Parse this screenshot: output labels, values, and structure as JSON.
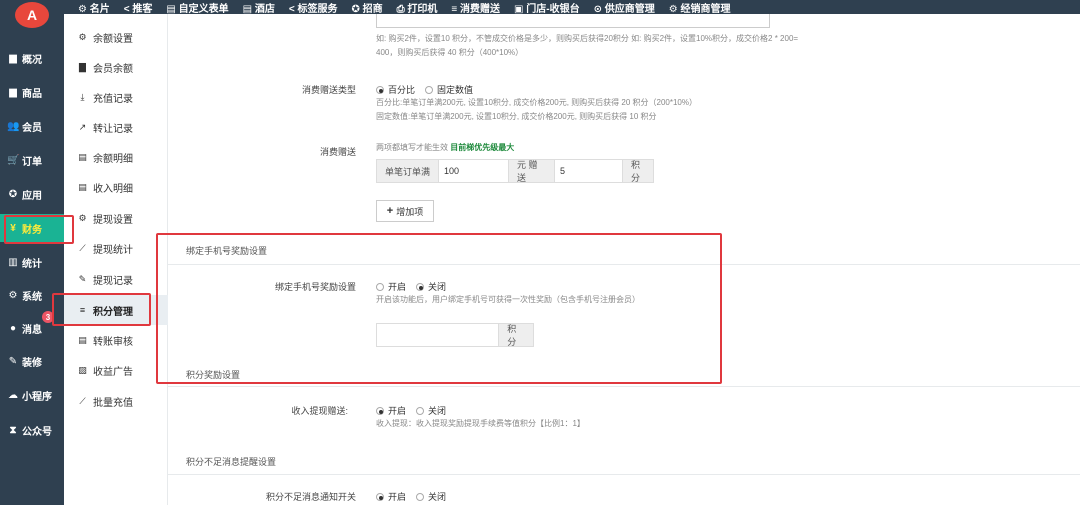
{
  "logo_text": "A",
  "top_nav": [
    "名片",
    "推客",
    "自定义表单",
    "酒店",
    "标签服务",
    "招商",
    "打印机",
    "消费赠送",
    "门店-收银台",
    "供应商管理",
    "经销商管理"
  ],
  "sidebar": [
    {
      "label": "概况",
      "icon": "square-icon"
    },
    {
      "label": "商品",
      "icon": "box-icon"
    },
    {
      "label": "会员",
      "icon": "users-icon"
    },
    {
      "label": "订单",
      "icon": "cart-icon"
    },
    {
      "label": "应用",
      "icon": "apps-icon"
    },
    {
      "label": "财务",
      "icon": "yen-icon",
      "active": true
    },
    {
      "label": "统计",
      "icon": "chart-icon"
    },
    {
      "label": "系统",
      "icon": "gears-icon"
    },
    {
      "label": "消息",
      "icon": "chat-icon"
    },
    {
      "label": "装修",
      "icon": "brush-icon"
    },
    {
      "label": "小程序",
      "icon": "wechat-icon"
    },
    {
      "label": "公众号",
      "icon": "hourglass-icon"
    }
  ],
  "sidebar_badge": "3",
  "submenu": [
    {
      "label": "余额设置",
      "icon": "gear-icon"
    },
    {
      "label": "会员余额",
      "icon": "book-icon"
    },
    {
      "label": "充值记录",
      "icon": "download-icon"
    },
    {
      "label": "转让记录",
      "icon": "external-icon"
    },
    {
      "label": "余额明细",
      "icon": "file-icon"
    },
    {
      "label": "收入明细",
      "icon": "file-icon"
    },
    {
      "label": "提现设置",
      "icon": "gear-icon"
    },
    {
      "label": "提现统计",
      "icon": "line-chart-icon"
    },
    {
      "label": "提现记录",
      "icon": "pencil-icon"
    },
    {
      "label": "积分管理",
      "icon": "database-icon",
      "active": true
    },
    {
      "label": "转账审核",
      "icon": "file-icon"
    },
    {
      "label": "收益广告",
      "icon": "image-icon"
    },
    {
      "label": "批量充值",
      "icon": "line-chart-icon"
    }
  ],
  "main": {
    "hint_top_1": "如: 购买2件，设置10 积分，不管成交价格是多少，则购买后获得20积分 如: 购买2件，设置10%积分，成交价格2 * 200=",
    "hint_top_2": "400，则购买后获得 40 积分（400*10%）",
    "consume_type_label": "消费赠送类型",
    "consume_type_opt1": "百分比",
    "consume_type_opt2": "固定数值",
    "consume_hint_1": "百分比:单笔订单满200元, 设置10积分, 成交价格200元, 则购买后获得 20 积分（200*10%）",
    "consume_hint_2": "固定数值:单笔订单满200元, 设置10积分, 成交价格200元, 则购买后获得 10 积分",
    "consume_gift_label": "消费赠送",
    "consume_gift_hint": "两项都填写才能生效",
    "consume_gift_hint_strong": "目前梯优先级最大",
    "order_full_addon": "单笔订单满",
    "order_full_value": "100",
    "yuan_gift_addon": "元 赠送",
    "gift_value": "5",
    "points_addon": "积分",
    "add_item_button": "增加项",
    "bind_section_title": "绑定手机号奖励设置",
    "bind_label": "绑定手机号奖励设置",
    "bind_opt_on": "开启",
    "bind_opt_off": "关闭",
    "bind_hint": "开启该功能后，用户绑定手机号可获得一次性奖励（包含手机号注册会员）",
    "bind_points_addon": "积分",
    "points_reward_title": "积分奖励设置",
    "income_label": "收入提现赠送:",
    "income_opt_on": "开启",
    "income_opt_off": "关闭",
    "income_hint": "收入提现：收入提现奖励提现手续费等值积分【比例1：1】",
    "insufficient_title": "积分不足消息提醒设置",
    "insufficient_label": "积分不足消息通知开关",
    "insufficient_opt_on": "开启",
    "insufficient_opt_off": "关闭"
  },
  "colors": {
    "sidebar_bg": "#2f4050",
    "active_green": "#1ab394",
    "highlight_red": "#e0383e"
  }
}
